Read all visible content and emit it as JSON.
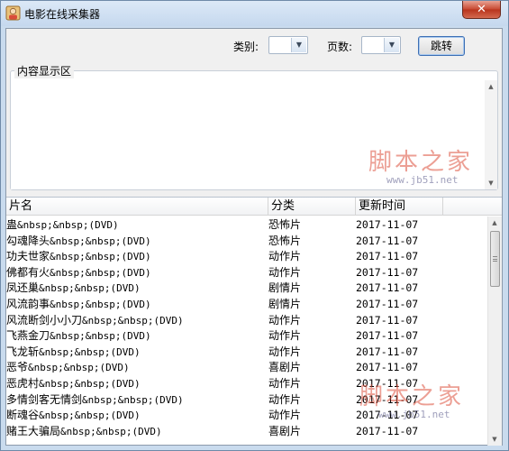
{
  "window": {
    "title": "电影在线采集器",
    "close_glyph": "✕"
  },
  "toolbar": {
    "category_label": "类别:",
    "category_value": "",
    "page_label": "页数:",
    "page_value": "",
    "jump_label": "跳转"
  },
  "content_group": {
    "legend": "内容显示区",
    "text": ""
  },
  "table": {
    "columns": [
      "片名",
      "分类",
      "更新时间"
    ],
    "rows": [
      {
        "name": "蛊",
        "suffix": "&nbsp;&nbsp;(DVD)",
        "category": "恐怖片",
        "date": "2017-11-07"
      },
      {
        "name": "勾魂降头",
        "suffix": "&nbsp;&nbsp;(DVD)",
        "category": "恐怖片",
        "date": "2017-11-07"
      },
      {
        "name": "功夫世家",
        "suffix": "&nbsp;&nbsp;(DVD)",
        "category": "动作片",
        "date": "2017-11-07"
      },
      {
        "name": "佛都有火",
        "suffix": "&nbsp;&nbsp;(DVD)",
        "category": "动作片",
        "date": "2017-11-07"
      },
      {
        "name": "凤还巢",
        "suffix": "&nbsp;&nbsp;(DVD)",
        "category": "剧情片",
        "date": "2017-11-07"
      },
      {
        "name": "风流韵事",
        "suffix": "&nbsp;&nbsp;(DVD)",
        "category": "剧情片",
        "date": "2017-11-07"
      },
      {
        "name": "风流断剑小小刀",
        "suffix": "&nbsp;&nbsp;(DVD)",
        "category": "动作片",
        "date": "2017-11-07"
      },
      {
        "name": "飞燕金刀",
        "suffix": "&nbsp;&nbsp;(DVD)",
        "category": "动作片",
        "date": "2017-11-07"
      },
      {
        "name": "飞龙斩",
        "suffix": "&nbsp;&nbsp;(DVD)",
        "category": "动作片",
        "date": "2017-11-07"
      },
      {
        "name": "恶爷",
        "suffix": "&nbsp;&nbsp;(DVD)",
        "category": "喜剧片",
        "date": "2017-11-07"
      },
      {
        "name": "恶虎村",
        "suffix": "&nbsp;&nbsp;(DVD)",
        "category": "动作片",
        "date": "2017-11-07"
      },
      {
        "name": "多情剑客无情剑",
        "suffix": "&nbsp;&nbsp;(DVD)",
        "category": "动作片",
        "date": "2017-11-07"
      },
      {
        "name": "断魂谷",
        "suffix": "&nbsp;&nbsp;(DVD)",
        "category": "动作片",
        "date": "2017-11-07"
      },
      {
        "name": "赌王大骗局",
        "suffix": "&nbsp;&nbsp;(DVD)",
        "category": "喜剧片",
        "date": "2017-11-07"
      }
    ]
  },
  "watermark": {
    "text": "脚本之家",
    "url": "www.jb51.net"
  },
  "colors": {
    "frame": "#c9dbee",
    "client_bg": "#f0f0f0",
    "button_border": "#3d6fb4",
    "close_red": "#c7472f"
  }
}
